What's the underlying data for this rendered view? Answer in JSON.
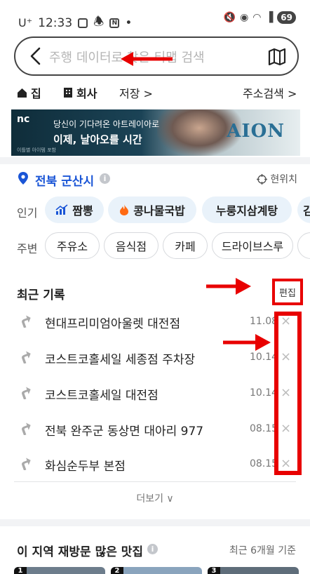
{
  "status_bar": {
    "carrier": "U⁺",
    "time": "12:33",
    "battery": "69"
  },
  "search": {
    "placeholder": "주행 데이터로 찾은 티맵 검색"
  },
  "quick_links": {
    "home": "집",
    "work": "회사",
    "saved": "저장 >",
    "address_search": "주소검색 >"
  },
  "banner": {
    "brand": "nc",
    "line1": "당신이 기다려온 아트레이아로",
    "line2": "이제, 날아오를 시간",
    "small": "이틀별 아이템 포함",
    "logo": "AION"
  },
  "location": {
    "name": "전북 군산시",
    "current_label": "현위치"
  },
  "popular": {
    "label": "인기",
    "chips": [
      "짬뽕",
      "콩나물국밥",
      "누룽지삼계탕",
      "김"
    ]
  },
  "nearby": {
    "label": "주변",
    "chips": [
      "주유소",
      "음식점",
      "카페",
      "드라이브스루",
      ""
    ]
  },
  "recent": {
    "title": "최근 기록",
    "edit_label": "편집",
    "items": [
      {
        "name": "현대프리미엄아울렛 대전점",
        "date": "11.08"
      },
      {
        "name": "코스트코홀세일 세종점 주차장",
        "date": "10.14"
      },
      {
        "name": "코스트코홀세일 대전점",
        "date": "10.14"
      },
      {
        "name": "전북 완주군 동상면 대아리 977",
        "date": "08.15"
      },
      {
        "name": "화심순두부 본점",
        "date": "08.15"
      }
    ],
    "more_label": "더보기 ∨"
  },
  "revisit": {
    "title": "이 지역 재방문 많은 맛집",
    "subtitle": "최근 6개월 기준",
    "ranks": [
      "1",
      "2",
      "3"
    ]
  },
  "colors": {
    "accent_blue": "#1a55d6",
    "annotation_red": "#e80000",
    "chip_bg": "#e9f2fa"
  }
}
